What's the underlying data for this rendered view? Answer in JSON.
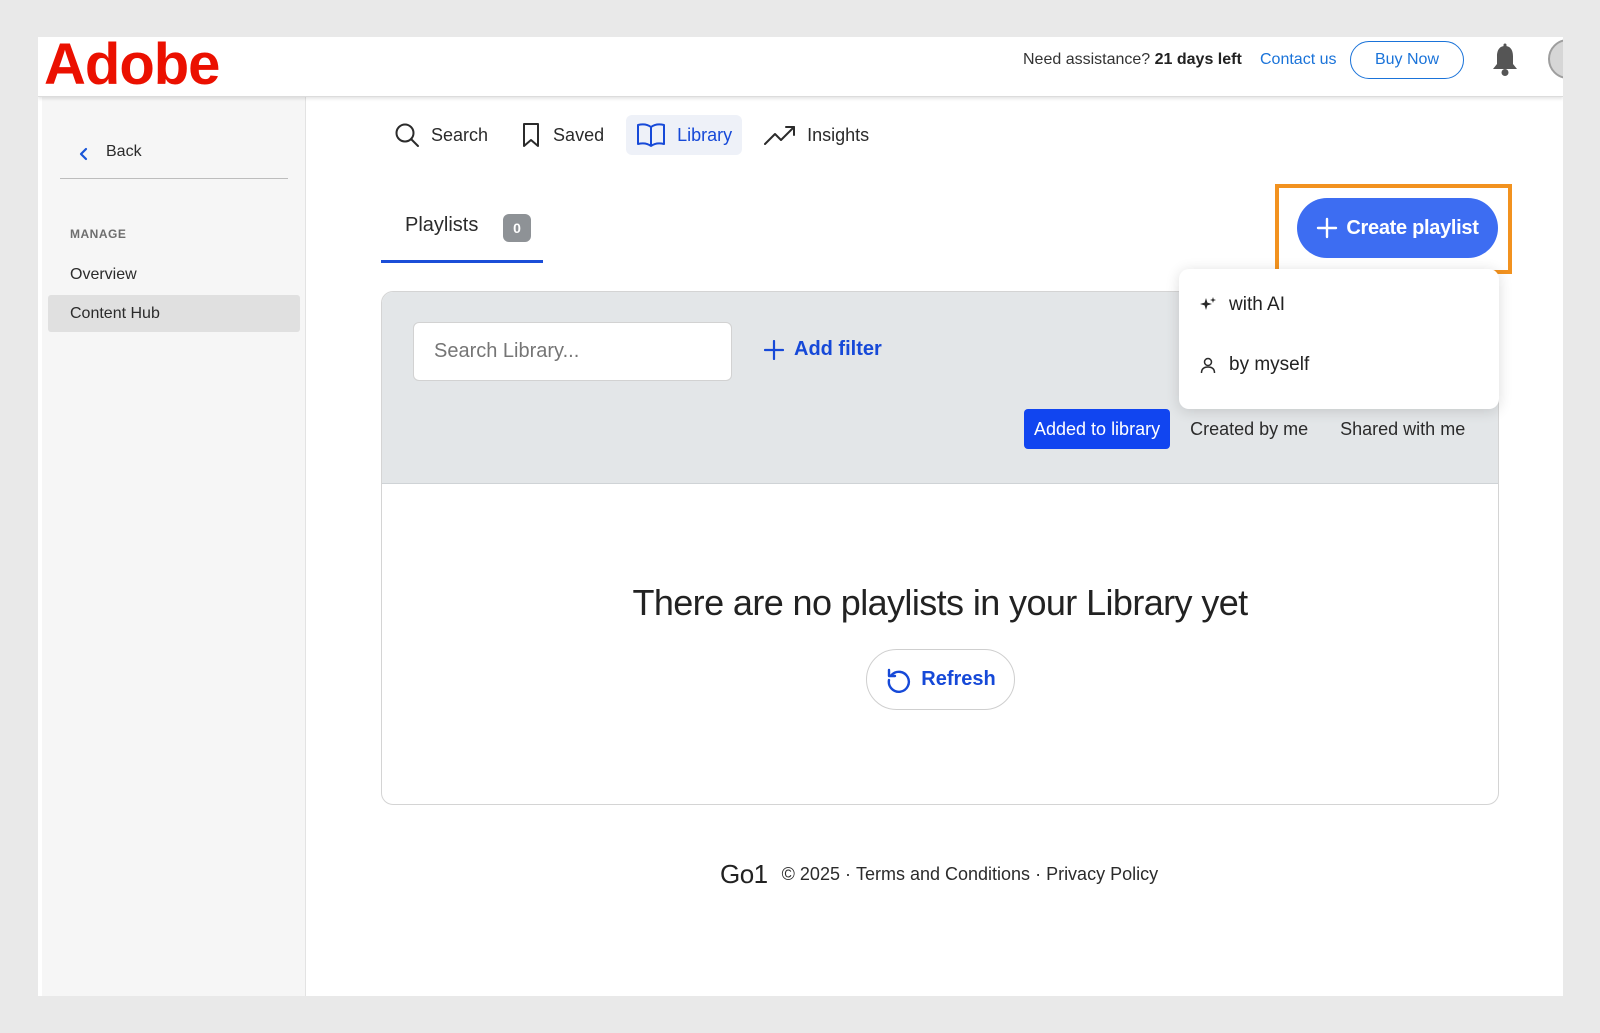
{
  "header": {
    "logo_text": "Adobe",
    "assist_text": "Need assistance?",
    "days_left": "21 days left",
    "contact_label": "Contact us",
    "buy_label": "Buy Now",
    "notification_icon": "bell-icon",
    "avatar_icon": "avatar"
  },
  "sidebar": {
    "back_label": "Back",
    "section_title": "MANAGE",
    "items": [
      {
        "label": "Overview",
        "active": false
      },
      {
        "label": "Content Hub",
        "active": true
      }
    ]
  },
  "nav": {
    "items": [
      {
        "label": "Search",
        "icon": "search-icon",
        "active": false
      },
      {
        "label": "Saved",
        "icon": "bookmark-icon",
        "active": false
      },
      {
        "label": "Library",
        "icon": "book-icon",
        "active": true
      },
      {
        "label": "Insights",
        "icon": "trending-up-icon",
        "active": false
      }
    ]
  },
  "library": {
    "tab_label": "Playlists",
    "tab_count": "0",
    "create_label": "Create playlist",
    "search_placeholder": "Search Library...",
    "add_filter_label": "Add filter",
    "segments": [
      {
        "label": "Added to library",
        "active": true
      },
      {
        "label": "Created by me",
        "active": false
      },
      {
        "label": "Shared with me",
        "active": false
      }
    ],
    "empty_message": "There are no playlists in your Library yet",
    "refresh_label": "Refresh"
  },
  "create_menu": {
    "items": [
      {
        "label": "with AI",
        "icon": "sparkle-icon"
      },
      {
        "label": "by myself",
        "icon": "person-icon"
      }
    ]
  },
  "footer": {
    "brand": "Go1",
    "copyright": "© 2025",
    "terms": "Terms and Conditions",
    "privacy": "Privacy Policy"
  },
  "colors": {
    "brand_red": "#eb1000",
    "accent_blue": "#1649d8",
    "create_button": "#3d6df2",
    "highlight_orange": "#f2921f",
    "active_segment": "#1145f0"
  }
}
